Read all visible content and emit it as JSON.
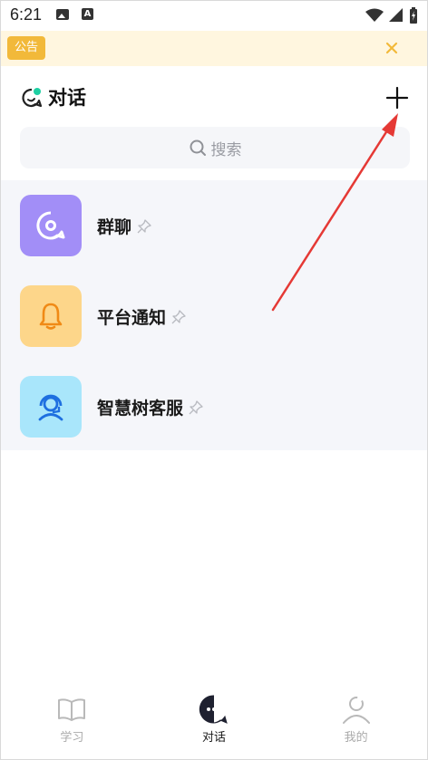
{
  "status_bar": {
    "time": "6:21",
    "a_icon_label": "A"
  },
  "notice": {
    "badge_label": "公告",
    "close_icon": "close-icon",
    "accent_color": "#f2b93a"
  },
  "header": {
    "title": "对话",
    "logo_icon": "chat-bubble-icon",
    "add_icon": "plus-icon"
  },
  "search": {
    "placeholder": "搜索",
    "icon": "search-icon"
  },
  "conversations": [
    {
      "name": "群聊",
      "avatar_color": "#a28ef7",
      "icon": "group-chat-icon",
      "pinned": true
    },
    {
      "name": "平台通知",
      "avatar_color": "#fdd68a",
      "icon": "bell-icon",
      "pinned": true
    },
    {
      "name": "智慧树客服",
      "avatar_color": "#a9e6fb",
      "icon": "customer-service-icon",
      "pinned": true
    }
  ],
  "bottom_nav": [
    {
      "label": "学习",
      "icon": "book-icon",
      "active": false
    },
    {
      "label": "对话",
      "icon": "chat-icon",
      "active": true
    },
    {
      "label": "我的",
      "icon": "profile-icon",
      "active": false
    }
  ]
}
